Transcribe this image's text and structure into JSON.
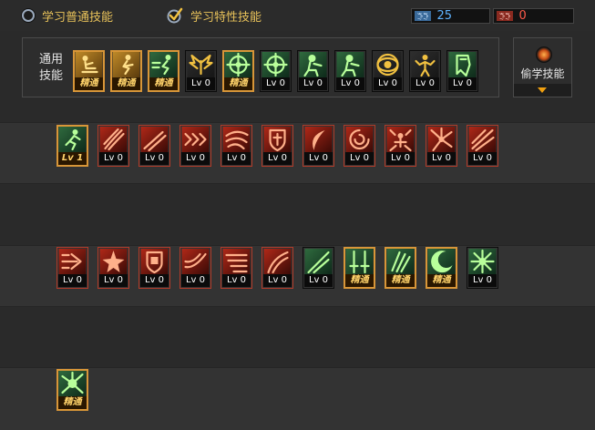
{
  "tabs": {
    "normal_label": "学习普通技能",
    "special_label": "学习特性技能"
  },
  "stats": {
    "blue": {
      "tag": "ꔓꔓ",
      "value": "25",
      "color": "#5fb3ff"
    },
    "red": {
      "tag": "ꔓꔓ",
      "value": "0",
      "color": "#ff5a4a"
    }
  },
  "common_skills": {
    "label": "通用技能",
    "items": [
      {
        "icon": "sitting-figure-icon",
        "caption": "精通",
        "elite": true,
        "theme": "gold"
      },
      {
        "icon": "crouching-figure-icon",
        "caption": "精通",
        "elite": true,
        "theme": "gold"
      },
      {
        "icon": "dashing-figure-icon",
        "caption": "精通",
        "elite": true,
        "theme": "green"
      },
      {
        "icon": "golden-wings-icon",
        "caption": "Lv 0",
        "elite": false,
        "theme": "dark"
      },
      {
        "icon": "crosshair-target-icon",
        "caption": "精通",
        "elite": true,
        "theme": "green"
      },
      {
        "icon": "crosshair-target-icon",
        "caption": "Lv 0",
        "elite": false,
        "theme": "green"
      },
      {
        "icon": "kneeling-soldier-icon",
        "caption": "Lv 0",
        "elite": false,
        "theme": "green"
      },
      {
        "icon": "kneeling-soldier-icon",
        "caption": "Lv 0",
        "elite": false,
        "theme": "green"
      },
      {
        "icon": "golden-eye-icon",
        "caption": "Lv 0",
        "elite": false,
        "theme": "dark"
      },
      {
        "icon": "flexing-strongman-icon",
        "caption": "Lv 0",
        "elite": false,
        "theme": "dark"
      },
      {
        "icon": "green-armor-icon",
        "caption": "Lv 0",
        "elite": false,
        "theme": "green"
      }
    ]
  },
  "steal_skill": {
    "label": "偷学技能"
  },
  "special_rows": [
    [
      {
        "icon": "running-man-icon",
        "caption": "Lv 1",
        "elite": true,
        "theme": "green"
      },
      {
        "icon": "claw-slash-icon",
        "caption": "Lv 0",
        "elite": false,
        "theme": "red"
      },
      {
        "icon": "double-slash-icon",
        "caption": "Lv 0",
        "elite": false,
        "theme": "red"
      },
      {
        "icon": "triple-chevron-icon",
        "caption": "Lv 0",
        "elite": false,
        "theme": "red"
      },
      {
        "icon": "whirlwind-icon",
        "caption": "Lv 0",
        "elite": false,
        "theme": "red"
      },
      {
        "icon": "shield-cross-icon",
        "caption": "Lv 0",
        "elite": false,
        "theme": "red"
      },
      {
        "icon": "crescent-slash-icon",
        "caption": "Lv 0",
        "elite": false,
        "theme": "red"
      },
      {
        "icon": "spin-slash-icon",
        "caption": "Lv 0",
        "elite": false,
        "theme": "red"
      },
      {
        "icon": "warrior-burst-icon",
        "caption": "Lv 0",
        "elite": false,
        "theme": "red"
      },
      {
        "icon": "spark-burst-icon",
        "caption": "Lv 0",
        "elite": false,
        "theme": "red"
      },
      {
        "icon": "wing-slash-icon",
        "caption": "Lv 0",
        "elite": false,
        "theme": "red"
      }
    ],
    [
      {
        "icon": "charge-strike-icon",
        "caption": "Lv 0",
        "elite": false,
        "theme": "red"
      },
      {
        "icon": "star-burst-icon",
        "caption": "Lv 0",
        "elite": false,
        "theme": "red"
      },
      {
        "icon": "fist-shield-icon",
        "caption": "Lv 0",
        "elite": false,
        "theme": "red"
      },
      {
        "icon": "swoosh-icon",
        "caption": "Lv 0",
        "elite": false,
        "theme": "red"
      },
      {
        "icon": "speed-lines-icon",
        "caption": "Lv 0",
        "elite": false,
        "theme": "red"
      },
      {
        "icon": "rising-slash-icon",
        "caption": "Lv 0",
        "elite": false,
        "theme": "red"
      },
      {
        "icon": "diagonal-slash-icon",
        "caption": "Lv 0",
        "elite": false,
        "theme": "green"
      },
      {
        "icon": "twin-swords-icon",
        "caption": "精通",
        "elite": true,
        "theme": "green"
      },
      {
        "icon": "green-claw-icon",
        "caption": "精通",
        "elite": true,
        "theme": "green"
      },
      {
        "icon": "crescent-moon-icon",
        "caption": "精通",
        "elite": true,
        "theme": "green"
      },
      {
        "icon": "cross-burst-icon",
        "caption": "Lv 0",
        "elite": false,
        "theme": "green"
      }
    ],
    [
      {
        "icon": "green-impact-icon",
        "caption": "精通",
        "elite": true,
        "theme": "green"
      }
    ]
  ]
}
